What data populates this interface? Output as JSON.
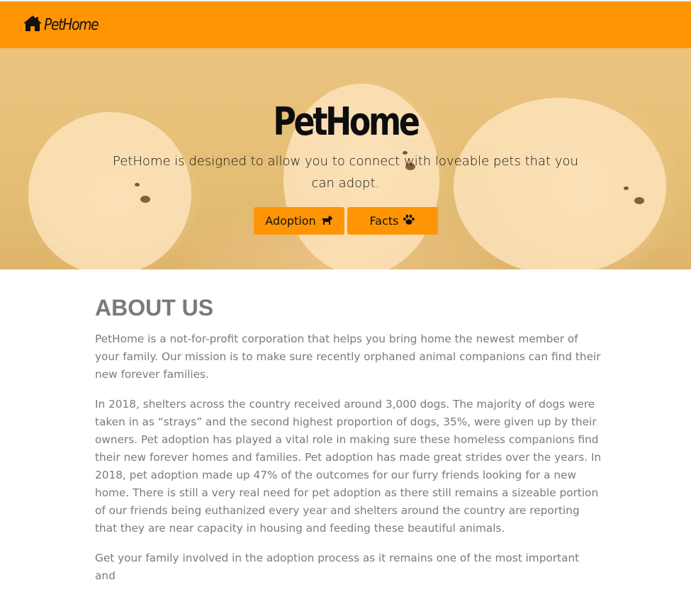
{
  "navbar": {
    "brand_name": "PetHome",
    "brand_icon": "home-icon"
  },
  "hero": {
    "title": "PetHome",
    "description": "PetHome is designed to allow you to connect with loveable pets that you can adopt.",
    "buttons": [
      {
        "label": "Adoption",
        "icon": "dog-icon"
      },
      {
        "label": "Facts",
        "icon": "paw-icon"
      }
    ]
  },
  "about": {
    "heading": "ABOUT US",
    "paragraphs": [
      "PetHome is a not-for-profit corporation that helps you bring home the newest member of your family. Our mission is to make sure recently orphaned animal companions can find their new forever families.",
      "In 2018, shelters across the country received around 3,000 dogs. The majority of dogs were taken in as “strays” and the second highest proportion of dogs, 35%, were given up by their owners. Pet adoption has played a vital role in making sure these homeless companions find their new forever homes and families. Pet adoption has made great strides over the years. In 2018, pet adoption made up 47% of the outcomes for our furry friends looking for a new home. There is still a very real need for pet adoption as there still remains a sizeable portion of our friends being euthanized every year and shelters around the country are reporting that they are near capacity in housing and feeding these beautiful animals.",
      "Get your family involved in the adoption process as it remains one of the most important and"
    ]
  },
  "colors": {
    "accent": "#ff9505",
    "text_dark": "#111111",
    "text_muted": "#7b7b7b"
  }
}
